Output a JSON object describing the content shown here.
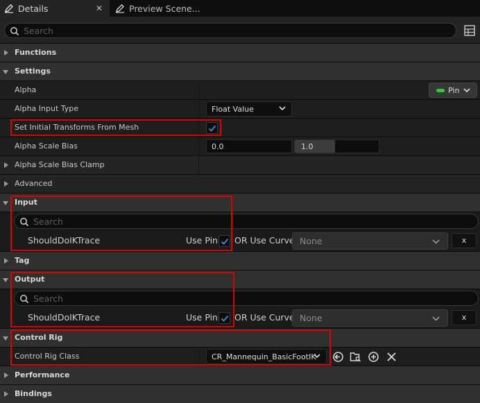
{
  "tabs": {
    "details_label": "Details",
    "preview_label": "Preview Scene..."
  },
  "search": {
    "placeholder": "Search"
  },
  "categories": {
    "functions": "Functions",
    "settings": "Settings",
    "alpha_scale_bias_clamp": "Alpha Scale Bias Clamp",
    "advanced": "Advanced",
    "input": "Input",
    "tag": "Tag",
    "output": "Output",
    "control_rig": "Control Rig",
    "performance": "Performance",
    "bindings": "Bindings"
  },
  "settings": {
    "alpha_label": "Alpha",
    "alpha_pin_label": "Pin",
    "alpha_input_type_label": "Alpha Input Type",
    "alpha_input_type_value": "Float Value",
    "set_initial_label": "Set Initial Transforms From Mesh",
    "set_initial_checked": true,
    "alpha_scale_bias_label": "Alpha Scale Bias",
    "alpha_scale_bias_min": "0.0",
    "alpha_scale_bias_max": "1.0"
  },
  "input": {
    "search_placeholder": "Search",
    "pin_name": "ShouldDoIKTrace",
    "use_pin_label": "Use Pin",
    "use_pin_checked": true,
    "or_use_curve_label": "OR Use Curve",
    "curve_value": "None",
    "clear_label": "x"
  },
  "output": {
    "search_placeholder": "Search",
    "pin_name": "ShouldDoIKTrace",
    "use_pin_label": "Use Pin",
    "use_pin_checked": true,
    "or_use_curve_label": "OR Use Curve",
    "curve_value": "None",
    "clear_label": "x"
  },
  "control_rig": {
    "class_label": "Control Rig Class",
    "class_value": "CR_Mannequin_BasicFootIK"
  },
  "colors": {
    "highlight": "#e00000",
    "pin_indicator": "#3ec43e",
    "checkmark": "#3f8fe0"
  }
}
